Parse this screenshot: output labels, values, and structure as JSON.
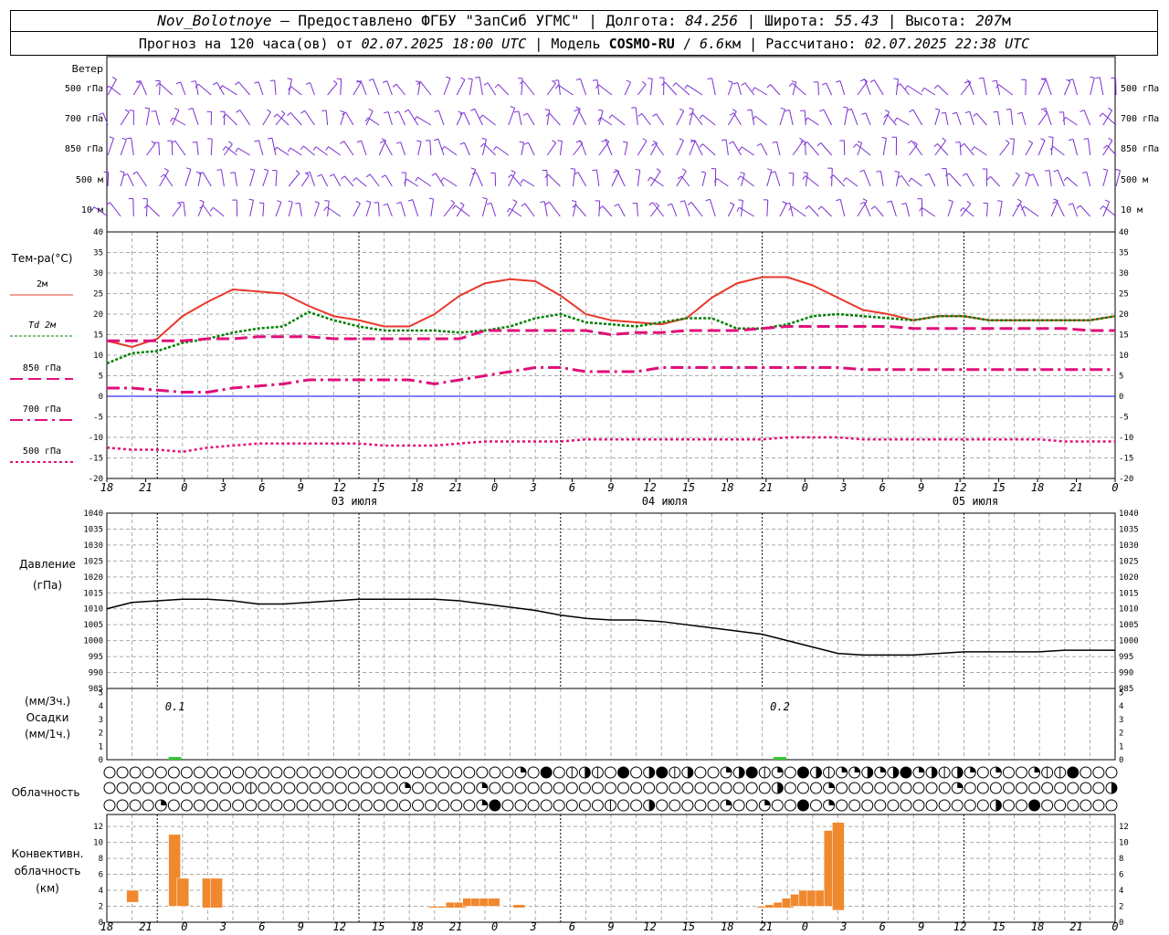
{
  "header": {
    "station": "Nov_Bolotnoye",
    "sep1": " – ",
    "provider": "Предоставлено ФГБУ \"ЗапСиб УГМС\"",
    "lon_label": "Долгота:",
    "lon": "84.256",
    "lat_label": "Широта:",
    "lat": "55.43",
    "alt_label": "Высота:",
    "alt": "207",
    "alt_unit": "м",
    "fc_label": "Прогноз на 120 часа(ов) от",
    "fc_time": "02.07.2025 18:00 UTC",
    "model_label": "Модель",
    "model": "COSMO-RU",
    "model_res": "6.6",
    "model_res_unit": "км",
    "calc_label": "Рассчитано:",
    "calc_time": "02.07.2025 22:38 UTC"
  },
  "wind": {
    "title": "Ветер",
    "levels": [
      "500 гПа",
      "700 гПа",
      "850 гПа",
      "500 м",
      "10 м"
    ]
  },
  "x_ticks": [
    "18",
    "21",
    "0",
    "3",
    "6",
    "9",
    "12",
    "15",
    "18",
    "21",
    "0",
    "3",
    "6",
    "9",
    "12",
    "15",
    "18",
    "21",
    "0",
    "3",
    "6",
    "9",
    "12",
    "15",
    "18",
    "21",
    "0"
  ],
  "dates": [
    "03 июля",
    "04 июля",
    "05 июля"
  ],
  "colors": {
    "t2m": "#e8382b",
    "td2m": "#008000",
    "t850": "#e0107a",
    "t700": "#e0107a",
    "t500": "#e0107a",
    "pressure": "#000000",
    "precip": "#33cc33",
    "conv": "#f0882e",
    "wind": "#7b2fd0",
    "zero": "#0000ff"
  },
  "chart_data": [
    {
      "type": "line",
      "panel": "temperature",
      "ylabel": "Тем-ра(°C)",
      "ylim": [
        -20,
        40
      ],
      "yticks": [
        40,
        35,
        30,
        25,
        20,
        15,
        10,
        5,
        0,
        -5,
        -10,
        -15,
        -20
      ],
      "legend": [
        "2м",
        "Td 2м",
        "850 гПа",
        "700 гПа",
        "500 гПа"
      ],
      "x": [
        0,
        3,
        6,
        9,
        12,
        15,
        18,
        21,
        24,
        27,
        30,
        33,
        36,
        39,
        42,
        45,
        48,
        51,
        54,
        57,
        60,
        63,
        66,
        69,
        72,
        75,
        78,
        81,
        84,
        87,
        90,
        93,
        96,
        99,
        102,
        105,
        108,
        111,
        114,
        117,
        120
      ],
      "series": [
        {
          "name": "2м",
          "values": [
            13.5,
            12,
            14,
            19.5,
            23,
            26,
            25.5,
            25,
            22,
            19.5,
            18.5,
            17,
            17,
            20,
            24.5,
            27.5,
            28.5,
            28,
            24.5,
            20,
            18.5,
            18,
            17.5,
            19,
            24,
            27.5,
            29,
            29,
            27,
            24,
            21,
            20,
            18.5,
            19.5,
            19.5,
            18.5,
            18.5,
            18.5,
            18.5,
            18.5,
            19.5
          ]
        },
        {
          "name": "Td 2м",
          "values": [
            8,
            10.5,
            11,
            13,
            14,
            15.5,
            16.5,
            17,
            20.5,
            18.5,
            17,
            16,
            16,
            16,
            15.5,
            16,
            17,
            19,
            20,
            18,
            17.5,
            17,
            18,
            19,
            19,
            16.5,
            16.5,
            17.5,
            19.5,
            20,
            19.5,
            19,
            18.5,
            19.5,
            19.5,
            18.5,
            18.5,
            18.5,
            18.5,
            18.5,
            19.5
          ]
        },
        {
          "name": "850 гПа",
          "values": [
            13.5,
            13.5,
            13.5,
            13.5,
            14,
            14,
            14.5,
            14.5,
            14.5,
            14,
            14,
            14,
            14,
            14,
            14,
            16,
            16,
            16,
            16,
            16,
            15,
            15.5,
            15.5,
            16,
            16,
            16,
            16.5,
            17,
            17,
            17,
            17,
            17,
            16.5,
            16.5,
            16.5,
            16.5,
            16.5,
            16.5,
            16.5,
            16,
            16
          ]
        },
        {
          "name": "700 гПа",
          "values": [
            2,
            2,
            1.5,
            1,
            1,
            2,
            2.5,
            3,
            4,
            4,
            4,
            4,
            4,
            3,
            4,
            5,
            6,
            7,
            7,
            6,
            6,
            6,
            7,
            7,
            7,
            7,
            7,
            7,
            7,
            7,
            6.5,
            6.5,
            6.5,
            6.5,
            6.5,
            6.5,
            6.5,
            6.5,
            6.5,
            6.5,
            6.5
          ]
        },
        {
          "name": "500 гПа",
          "values": [
            -12.5,
            -13,
            -13,
            -13.5,
            -12.5,
            -12,
            -11.5,
            -11.5,
            -11.5,
            -11.5,
            -11.5,
            -12,
            -12,
            -12,
            -11.5,
            -11,
            -11,
            -11,
            -11,
            -10.5,
            -10.5,
            -10.5,
            -10.5,
            -10.5,
            -10.5,
            -10.5,
            -10.5,
            -10,
            -10,
            -10,
            -10.5,
            -10.5,
            -10.5,
            -10.5,
            -10.5,
            -10.5,
            -10.5,
            -10.5,
            -11,
            -11,
            -11
          ]
        }
      ]
    },
    {
      "type": "line",
      "panel": "pressure",
      "ylabel": "Давление",
      "yunit": "(гПа)",
      "ylim": [
        985,
        1040
      ],
      "yticks": [
        1040,
        1035,
        1030,
        1025,
        1020,
        1015,
        1010,
        1005,
        1000,
        995,
        990,
        985
      ],
      "x": [
        0,
        3,
        6,
        9,
        12,
        15,
        18,
        21,
        24,
        27,
        30,
        33,
        36,
        39,
        42,
        45,
        48,
        51,
        54,
        57,
        60,
        63,
        66,
        69,
        72,
        75,
        78,
        81,
        84,
        87,
        90,
        93,
        96,
        99,
        102,
        105,
        108,
        111,
        114,
        117,
        120
      ],
      "values": [
        1010,
        1012,
        1012.5,
        1013,
        1013,
        1012.5,
        1011.5,
        1011.5,
        1012,
        1012.5,
        1013,
        1013,
        1013,
        1013,
        1012.5,
        1011.5,
        1010.5,
        1009.5,
        1008,
        1007,
        1006.5,
        1006.5,
        1006,
        1005,
        1004,
        1003,
        1002,
        1000,
        998,
        996,
        995.5,
        995.5,
        995.5,
        996,
        996.5,
        996.5,
        996.5,
        996.5,
        997,
        997,
        997
      ]
    },
    {
      "type": "bar",
      "panel": "precipitation",
      "ylabel": "Осадки",
      "yunits": [
        "(мм/3ч.)",
        "(мм/1ч.)"
      ],
      "ylim": [
        0,
        5
      ],
      "x": [
        8,
        80
      ],
      "values": [
        0.1,
        0.2
      ],
      "labels": [
        "0.1",
        "0.2"
      ]
    },
    {
      "type": "table",
      "panel": "cloudiness",
      "ylabel": "Облачность",
      "levels": [
        "high",
        "middle",
        "low"
      ]
    },
    {
      "type": "bar",
      "panel": "convective",
      "ylabel": "Конвективн. облачность (км)",
      "ylim": [
        0,
        13
      ],
      "yticks": [
        12,
        10,
        8,
        6,
        4,
        2,
        0
      ],
      "bars": [
        {
          "x": 3,
          "bottom": 2.5,
          "top": 4
        },
        {
          "x": 8,
          "bottom": 2,
          "top": 11
        },
        {
          "x": 9,
          "bottom": 2,
          "top": 5.5
        },
        {
          "x": 12,
          "bottom": 1.8,
          "top": 5.5
        },
        {
          "x": 13,
          "bottom": 1.8,
          "top": 5.5
        },
        {
          "x": 39,
          "bottom": 1.8,
          "top": 2
        },
        {
          "x": 40,
          "bottom": 1.8,
          "top": 2
        },
        {
          "x": 41,
          "bottom": 1.8,
          "top": 2.5
        },
        {
          "x": 42,
          "bottom": 1.8,
          "top": 2.5
        },
        {
          "x": 43,
          "bottom": 2,
          "top": 3
        },
        {
          "x": 44,
          "bottom": 2,
          "top": 3
        },
        {
          "x": 45,
          "bottom": 2,
          "top": 3
        },
        {
          "x": 46,
          "bottom": 2,
          "top": 3
        },
        {
          "x": 49,
          "bottom": 1.8,
          "top": 2.2
        },
        {
          "x": 78,
          "bottom": 1.8,
          "top": 2
        },
        {
          "x": 79,
          "bottom": 1.8,
          "top": 2.2
        },
        {
          "x": 80,
          "bottom": 1.8,
          "top": 2.5
        },
        {
          "x": 81,
          "bottom": 1.8,
          "top": 3
        },
        {
          "x": 82,
          "bottom": 2,
          "top": 3.5
        },
        {
          "x": 83,
          "bottom": 2,
          "top": 4
        },
        {
          "x": 84,
          "bottom": 2,
          "top": 4
        },
        {
          "x": 85,
          "bottom": 2,
          "top": 4
        },
        {
          "x": 86,
          "bottom": 2,
          "top": 11.5
        },
        {
          "x": 87,
          "bottom": 1.5,
          "top": 12.5
        }
      ]
    }
  ]
}
